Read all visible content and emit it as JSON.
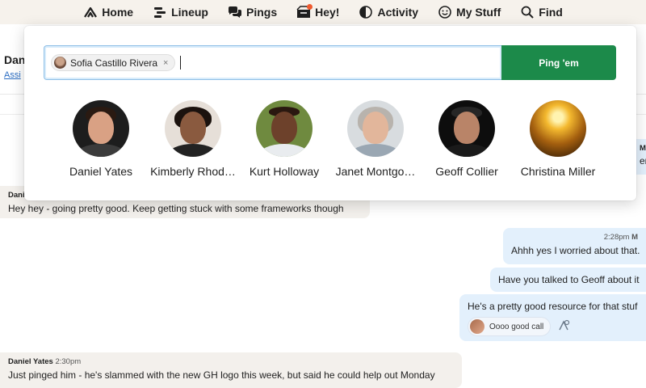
{
  "nav": {
    "items": [
      {
        "label": "Home",
        "icon": "home-icon"
      },
      {
        "label": "Lineup",
        "icon": "lineup-icon"
      },
      {
        "label": "Pings",
        "icon": "pings-icon"
      },
      {
        "label": "Hey!",
        "icon": "hey-icon"
      },
      {
        "label": "Activity",
        "icon": "activity-icon"
      },
      {
        "label": "My Stuff",
        "icon": "my-stuff-icon"
      },
      {
        "label": "Find",
        "icon": "find-icon"
      }
    ],
    "accent": "#ef5a2f"
  },
  "background": {
    "title": "Dan",
    "link": "Assi"
  },
  "popover": {
    "token": "Sofia Castillo Rivera",
    "token_remove": "×",
    "button_label": "Ping 'em",
    "button_color": "#1c8a4a",
    "people": [
      {
        "name": "Daniel Yates"
      },
      {
        "name": "Kimberly Rhod…"
      },
      {
        "name": "Kurt Holloway"
      },
      {
        "name": "Janet Montgo…"
      },
      {
        "name": "Geoff Collier"
      },
      {
        "name": "Christina Miller"
      }
    ]
  },
  "chat": {
    "msg1": {
      "author": "Dani",
      "text": "Hey hey - going pretty good. Keep getting stuck with some frameworks though"
    },
    "msg2": {
      "time": "2:28pm",
      "author": "M",
      "text": "Ahhh yes I worried about that."
    },
    "msg3": {
      "text": "Have you talked to Geoff about it"
    },
    "msg4": {
      "text": "He's a pretty good resource for that stuf",
      "boost": "Oooo good call"
    },
    "msg5": {
      "author": "Daniel Yates",
      "time": "2:30pm",
      "text": "Just pinged him - he's slammed with the new GH logo this week, but said he could help out Monday"
    },
    "partial_right_1": "M",
    "partial_right_2": "en"
  }
}
